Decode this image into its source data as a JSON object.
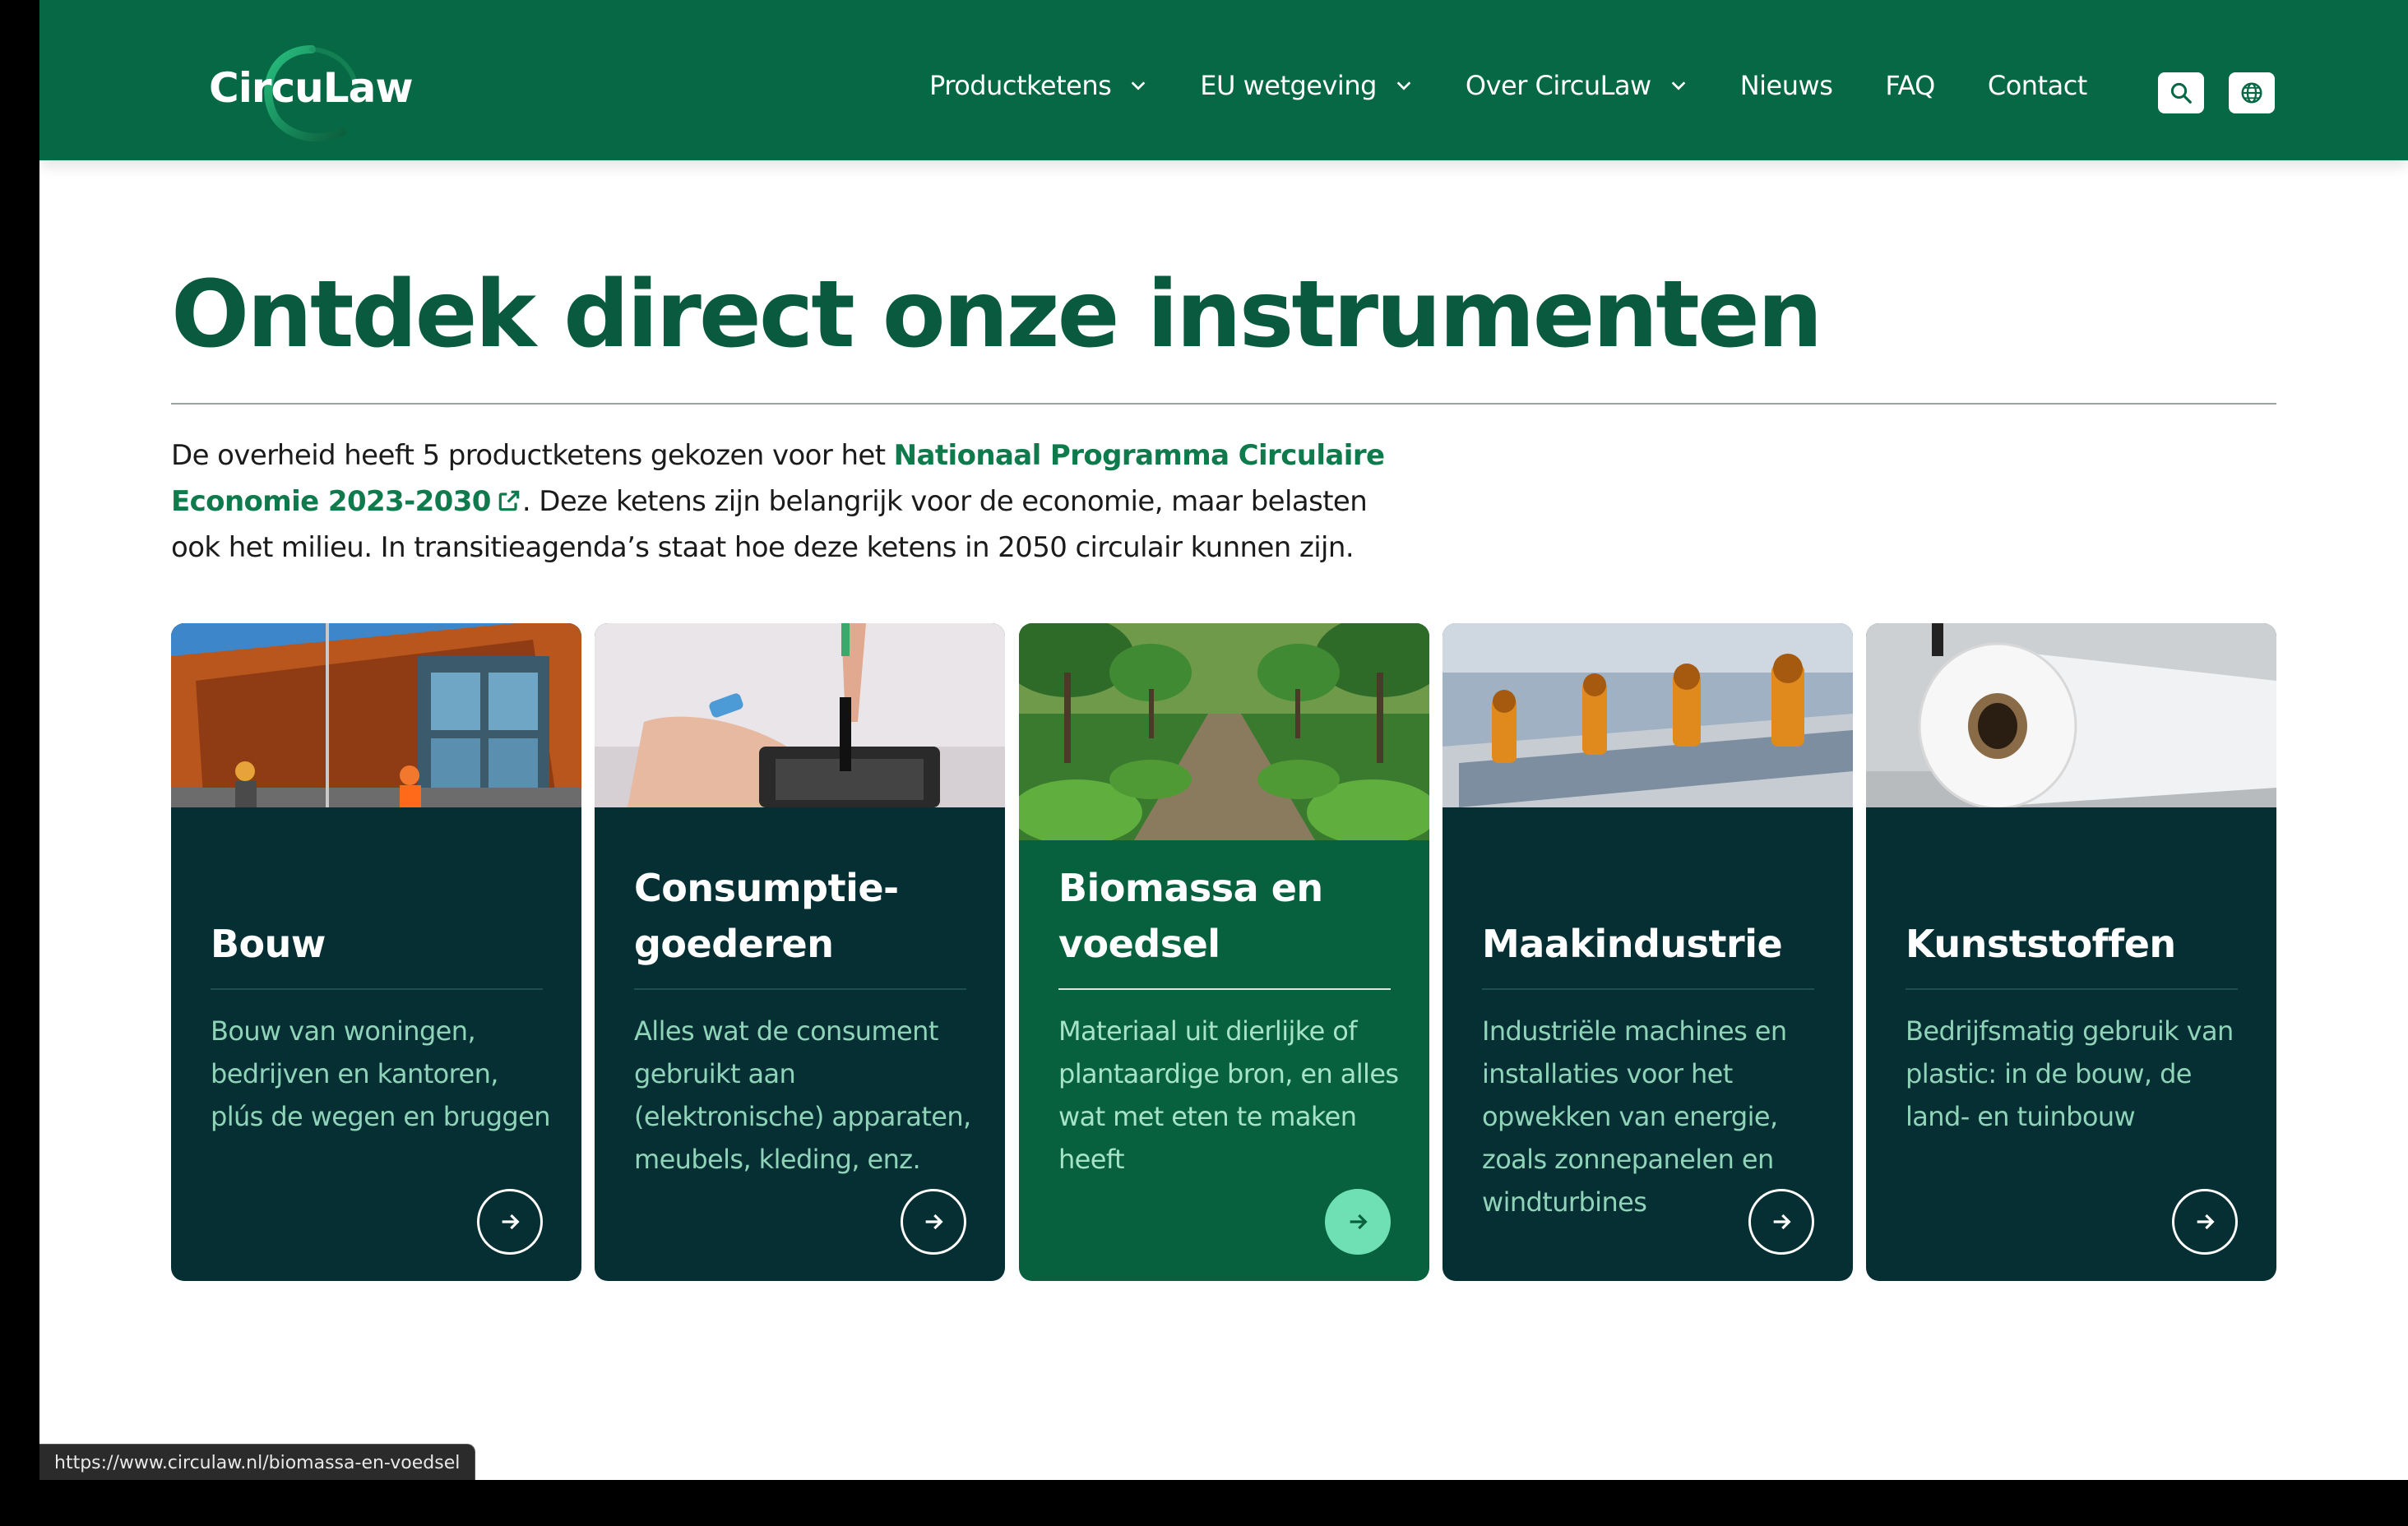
{
  "brand": {
    "logo_text": "CircuLaw",
    "primary_color": "#066844",
    "dark_card_color": "#062f33",
    "accent_color": "#6fe0b4"
  },
  "nav": {
    "items": [
      {
        "label": "Productketens",
        "has_dropdown": true
      },
      {
        "label": "EU wetgeving",
        "has_dropdown": true
      },
      {
        "label": "Over CircuLaw",
        "has_dropdown": true
      },
      {
        "label": "Nieuws",
        "has_dropdown": false
      },
      {
        "label": "FAQ",
        "has_dropdown": false
      },
      {
        "label": "Contact",
        "has_dropdown": false
      }
    ],
    "search_icon": "search-icon",
    "language_icon": "globe-icon"
  },
  "main": {
    "title": "Ontdek direct onze instrumenten",
    "intro_before": "De overheid heeft 5 productketens gekozen voor het ",
    "intro_link": "Nationaal Programma Circulaire Economie 2023-2030",
    "intro_after": ". Deze ketens zijn belangrijk voor de economie, maar belasten ook het milieu. In transitieagenda’s staat hoe deze ketens in 2050 circulair kunnen zijn."
  },
  "cards": [
    {
      "title": "Bouw",
      "description": "Bouw van woningen, bedrijven en kantoren, plús de wegen en bruggen",
      "image": "construction-workers-facade",
      "active": false
    },
    {
      "title": "Consumptie-goederen",
      "description": "Alles wat de consument gebruikt aan (elektronische) apparaten, meubels, kleding, enz.",
      "image": "phone-repair-hands",
      "active": false
    },
    {
      "title": "Biomassa en voedsel",
      "description": "Materiaal uit dierlijke of plantaardige bron, en alles wat met eten te maken heeft",
      "image": "tree-lined-path-crops",
      "active": true
    },
    {
      "title": "Maakindustrie",
      "description": "Industriële machines en installaties voor het opwekken van energie, zoals zonnepanelen en windturbines",
      "image": "robot-arms-solar-panels",
      "active": false
    },
    {
      "title": "Kunststoffen",
      "description": "Bedrijfsmatig gebruik van plastic: in de bouw, de land- en tuinbouw",
      "image": "plastic-film-roll",
      "active": false
    }
  ],
  "statusbar": {
    "url": "https://www.circulaw.nl/biomassa-en-voedsel"
  }
}
